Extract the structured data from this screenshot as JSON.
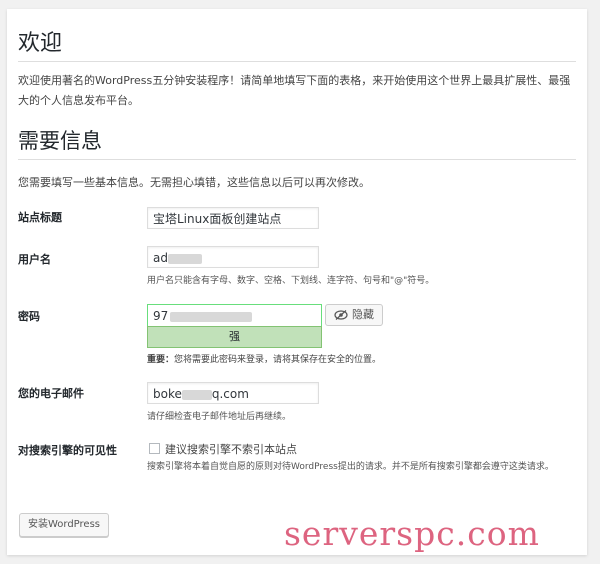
{
  "welcome": {
    "title": "欢迎",
    "intro": "欢迎使用著名的WordPress五分钟安装程序！请简单地填写下面的表格，来开始使用这个世界上最具扩展性、最强大的个人信息发布平台。"
  },
  "info": {
    "title": "需要信息",
    "description": "您需要填写一些基本信息。无需担心填错，这些信息以后可以再次修改。"
  },
  "fields": {
    "site_title": {
      "label": "站点标题",
      "value": "宝塔Linux面板创建站点"
    },
    "username": {
      "label": "用户名",
      "value": "ad",
      "hint": "用户名只能含有字母、数字、空格、下划线、连字符、句号和\"@\"符号。"
    },
    "password": {
      "label": "密码",
      "value_start": "97",
      "strength": "强",
      "hide_label": "隐藏",
      "warning_label": "重要：",
      "warning_text": "您将需要此密码来登录，请将其保存在安全的位置。"
    },
    "email": {
      "label": "您的电子邮件",
      "value_start": "boke",
      "value_end": "q.com",
      "hint": "请仔细检查电子邮件地址后再继续。"
    },
    "visibility": {
      "label": "对搜索引擎的可见性",
      "checkbox_label": "建议搜索引擎不索引本站点",
      "hint": "搜索引擎将本着自觉自愿的原则对待WordPress提出的请求。并不是所有搜索引擎都会遵守这类请求。"
    }
  },
  "install_button": "安装WordPress",
  "watermark": "serverspc.com"
}
